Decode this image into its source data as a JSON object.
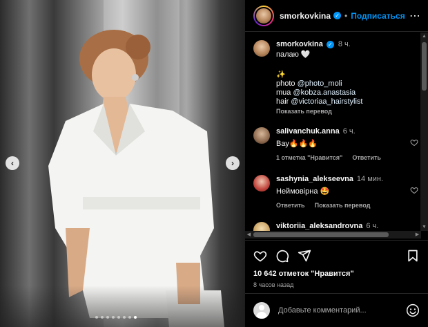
{
  "post": {
    "username": "smorkovkina",
    "follow_label": "Подписаться",
    "separator": "•",
    "more_icon": "more-horizontal-icon"
  },
  "photo": {
    "prev_icon": "chevron-left-icon",
    "next_icon": "chevron-right-icon",
    "prev_glyph": "‹",
    "next_glyph": "›",
    "slides_count": 8,
    "active_slide": 8
  },
  "caption": {
    "username": "smorkovkina",
    "time": "8 ч.",
    "line1": "палаю 🤍",
    "sparkle": "✨",
    "photo_prefix": "photo ",
    "photo_link": "@photo_moli",
    "mua_prefix": "mua ",
    "mua_link": "@kobza.anastasia",
    "hair_prefix": "hair ",
    "hair_link": "@victoriaa_hairstylist",
    "translate": "Показать перевод"
  },
  "comments": [
    {
      "username": "salivanchuk.anna",
      "time": "6 ч.",
      "text": "Вау🔥🔥🔥",
      "likes": "1 отметка \"Нравится\"",
      "reply": "Ответить",
      "translate": ""
    },
    {
      "username": "sashynia_alekseevna",
      "time": "14 мин.",
      "text": "Неймовірна 🤩",
      "likes": "",
      "reply": "Ответить",
      "translate": "Показать перевод"
    },
    {
      "username": "viktoriia_aleksandrovna",
      "time": "6 ч.",
      "text": "",
      "likes": "",
      "reply": "",
      "translate": ""
    }
  ],
  "actions": {
    "likes": "10 642 отметок \"Нравится\"",
    "posted": "8 часов назад"
  },
  "comment_bar": {
    "placeholder": "Добавьте комментарий..."
  },
  "colors": {
    "accent": "#0095f6",
    "background": "#000000",
    "muted": "#a8a8a8"
  }
}
